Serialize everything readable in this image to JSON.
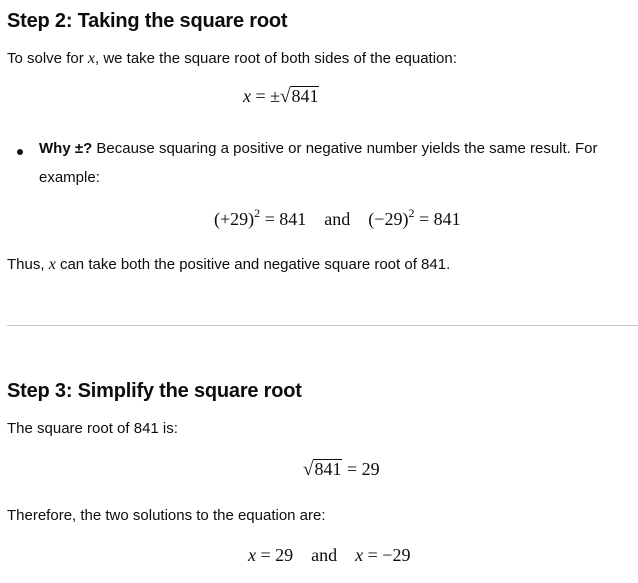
{
  "step2": {
    "heading": "Step 2: Taking the square root",
    "intro_pre": "To solve for ",
    "intro_var": "x",
    "intro_post": ", we take the square root of both sides of the equation:",
    "eq1": {
      "lhs": "x",
      "eq": "=",
      "pm": "±",
      "radicand": "841"
    },
    "bullet": {
      "bold": "Why ±?",
      "text": " Because squaring a positive or negative number yields the same result. For",
      "text2": "example:"
    },
    "eq2": {
      "left_base": "(+29)",
      "left_exp": "2",
      "left_rhs": "= 841",
      "conj": "and",
      "right_base": "(−29)",
      "right_exp": "2",
      "right_rhs": "= 841"
    },
    "thus_pre": "Thus, ",
    "thus_var": "x",
    "thus_post": " can take both the positive and negative square root of 841."
  },
  "step3": {
    "heading": "Step 3: Simplify the square root",
    "intro": "The square root of 841 is:",
    "eq1": {
      "radicand": "841",
      "rhs": "= 29"
    },
    "therefore": "Therefore, the two solutions to the equation are:",
    "eq2": {
      "var1": "x",
      "val1": "= 29",
      "conj": "and",
      "var2": "x",
      "val2": "= −29"
    }
  }
}
